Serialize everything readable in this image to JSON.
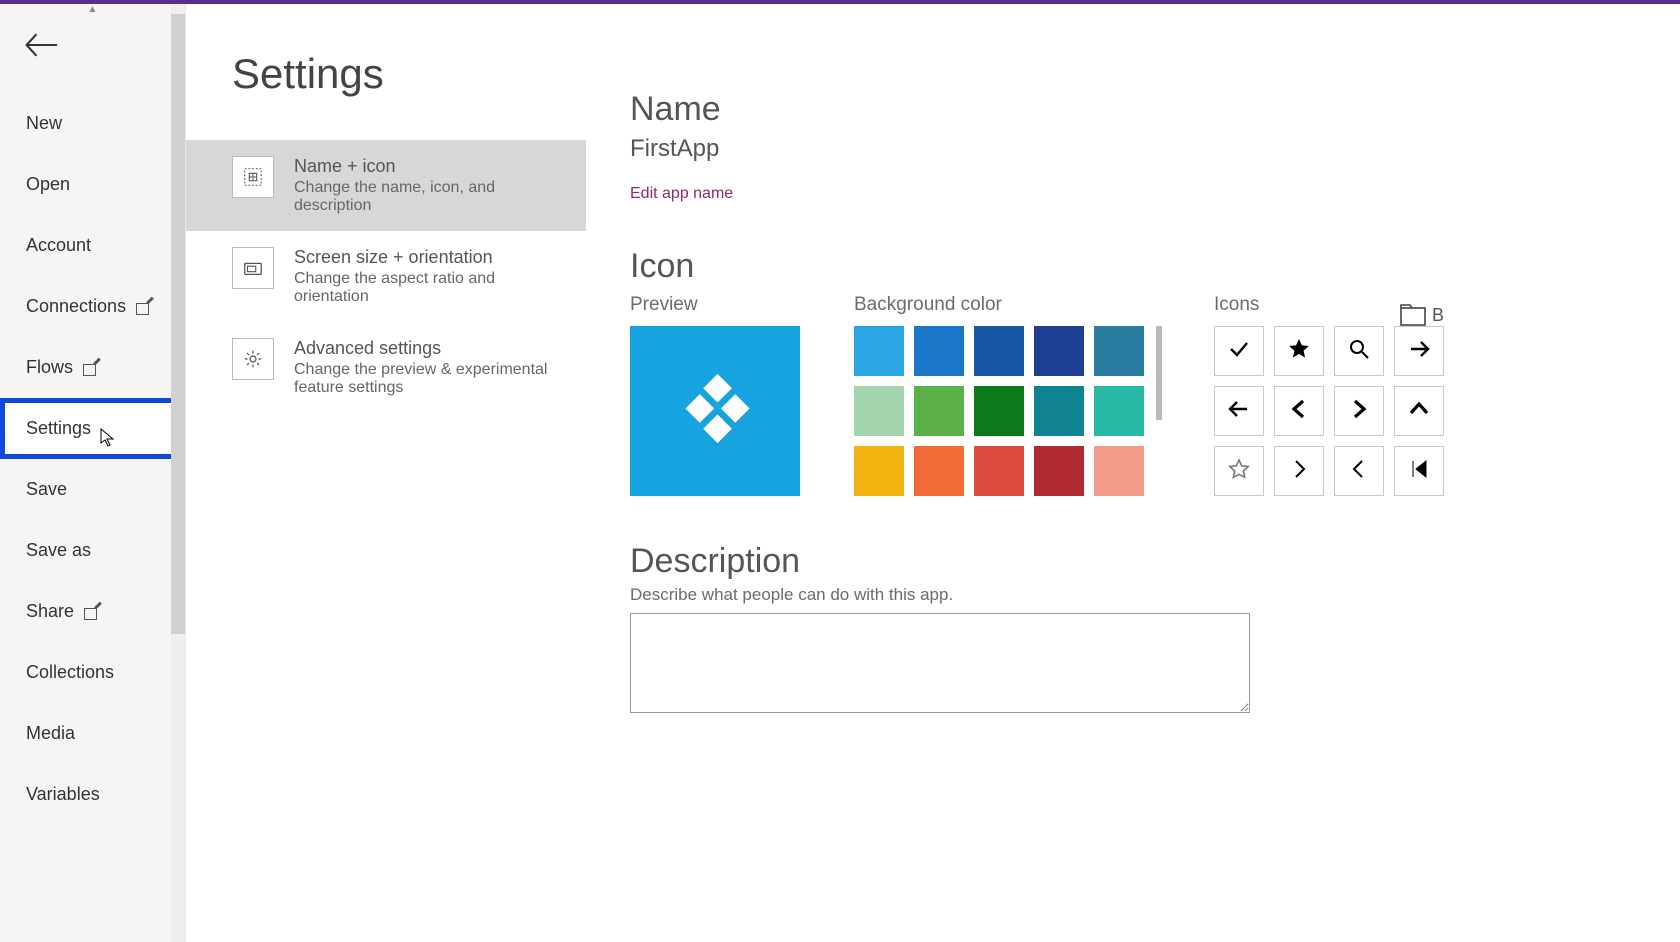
{
  "sidebar": {
    "items": [
      {
        "label": "New",
        "external": false
      },
      {
        "label": "Open",
        "external": false
      },
      {
        "label": "Account",
        "external": false
      },
      {
        "label": "Connections",
        "external": true
      },
      {
        "label": "Flows",
        "external": true
      },
      {
        "label": "Settings",
        "external": false,
        "highlighted": true
      },
      {
        "label": "Save",
        "external": false
      },
      {
        "label": "Save as",
        "external": false
      },
      {
        "label": "Share",
        "external": true
      },
      {
        "label": "Collections",
        "external": false
      },
      {
        "label": "Media",
        "external": false
      },
      {
        "label": "Variables",
        "external": false
      }
    ]
  },
  "page": {
    "title": "Settings"
  },
  "settings_cards": [
    {
      "title": "Name + icon",
      "desc": "Change the name, icon, and description",
      "selected": true,
      "icon": "name-icon"
    },
    {
      "title": "Screen size + orientation",
      "desc": "Change the aspect ratio and orientation",
      "selected": false,
      "icon": "screen-icon"
    },
    {
      "title": "Advanced settings",
      "desc": "Change the preview & experimental feature settings",
      "selected": false,
      "icon": "gear-icon"
    }
  ],
  "name": {
    "heading": "Name",
    "value": "FirstApp",
    "edit_label": "Edit app name"
  },
  "icon": {
    "heading": "Icon",
    "preview_label": "Preview",
    "bgcolor_label": "Background color",
    "icons_label": "Icons",
    "browse_label": "B",
    "preview_bg": "#16a3e0",
    "bg_colors": [
      "#2aa7e4",
      "#1976c8",
      "#1557a5",
      "#1f3f94",
      "#2a7ca0",
      "#a4d5ae",
      "#5bb04a",
      "#0b7a1a",
      "#0e8493",
      "#27b8a6",
      "#f2b20f",
      "#f26a34",
      "#dd4b3e",
      "#b02c32",
      "#f39a89"
    ],
    "icon_names": [
      "check-icon",
      "star-filled-icon",
      "search-icon",
      "arrow-right-icon",
      "arrow-left-icon",
      "chevron-left-bold-icon",
      "chevron-right-bold-icon",
      "chevron-up-bold-icon",
      "star-outline-icon",
      "chevron-right-icon",
      "chevron-left-icon",
      "skip-first-icon"
    ]
  },
  "description": {
    "heading": "Description",
    "hint": "Describe what people can do with this app.",
    "value": ""
  }
}
